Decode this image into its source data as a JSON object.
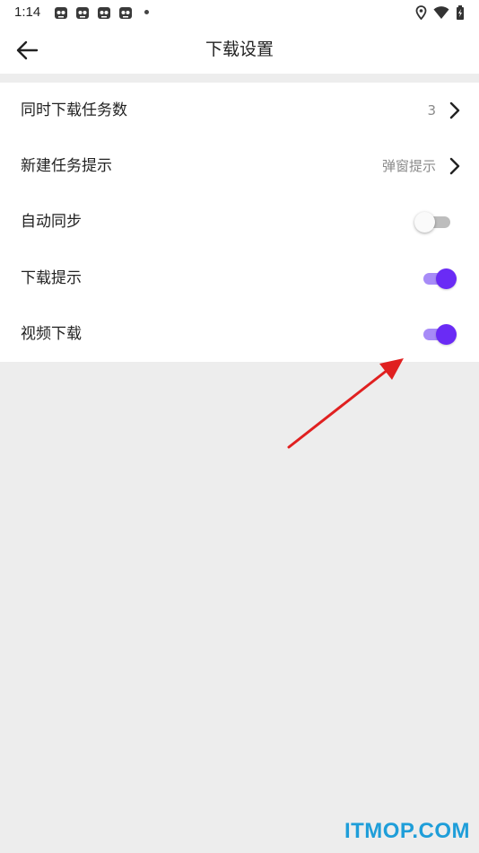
{
  "status_bar": {
    "time": "1:14",
    "notification_icons": [
      "cat-notification-icon",
      "cat-notification-icon",
      "cat-notification-icon",
      "cat-notification-icon"
    ],
    "system_icons": [
      "location-icon",
      "wifi-icon",
      "battery-charging-icon"
    ]
  },
  "header": {
    "title": "下载设置",
    "back_icon": "arrow-left-icon"
  },
  "settings": {
    "items": [
      {
        "label": "同时下载任务数",
        "value": "3",
        "control": "chevron"
      },
      {
        "label": "新建任务提示",
        "value": "弹窗提示",
        "control": "chevron"
      },
      {
        "label": "自动同步",
        "control": "toggle",
        "enabled": false
      },
      {
        "label": "下载提示",
        "control": "toggle",
        "enabled": true
      },
      {
        "label": "视频下载",
        "control": "toggle",
        "enabled": true
      }
    ]
  },
  "colors": {
    "accent": "#6a2bf5",
    "accent_track": "#a78bf7",
    "background": "#ededed",
    "surface": "#ffffff",
    "annotation_arrow": "#e02020",
    "watermark": "#1f9ed9"
  },
  "watermark": {
    "text": "ITMOP.COM"
  }
}
